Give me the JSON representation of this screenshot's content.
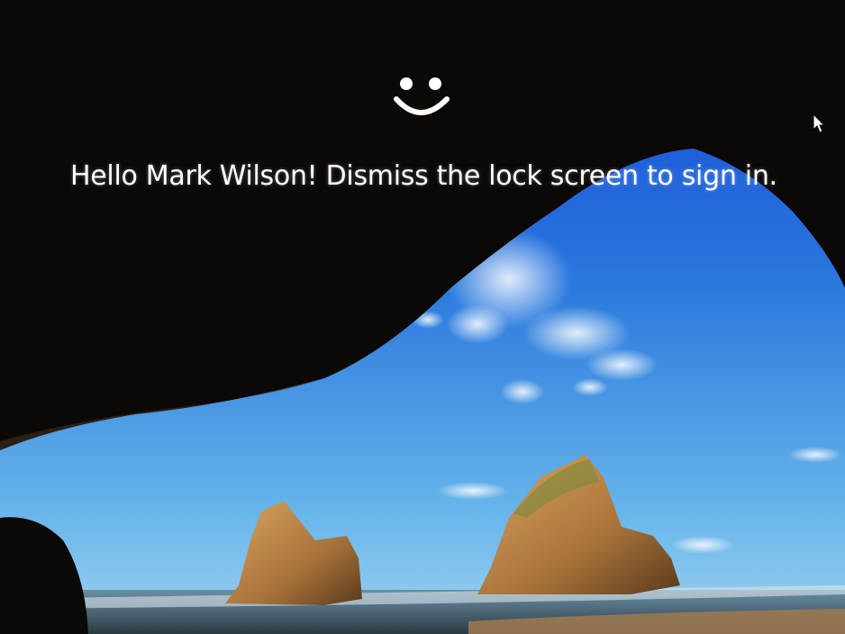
{
  "lock_screen": {
    "greeting": "Hello Mark Wilson! Dismiss the lock screen to sign in.",
    "face_icon": "smiley-face-icon",
    "cursor_icon": "mouse-pointer-icon"
  },
  "colors": {
    "text": "#ffffff",
    "sky": "#1b5fd6",
    "cave": "#0c0806"
  }
}
